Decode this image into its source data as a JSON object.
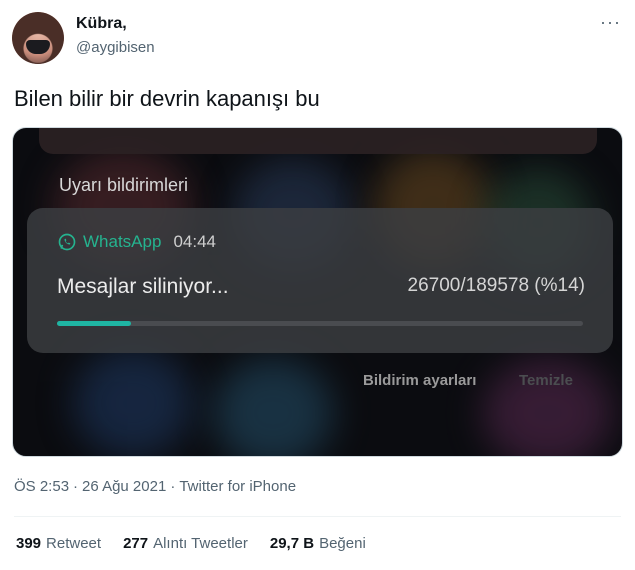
{
  "tweet": {
    "author_name": "Kübra,",
    "author_handle": "@aygibisen",
    "text": "Bilen bilir bir devrin kapanışı bu",
    "more_glyph": "···",
    "timestamp": "ÖS 2:53",
    "separator1": "·",
    "date": "26 Ağu 2021",
    "separator2": "·",
    "source": "Twitter for iPhone"
  },
  "media": {
    "section_title": "Uyarı bildirimleri",
    "notification": {
      "app_icon": "whatsapp-icon",
      "app_name": "WhatsApp",
      "time": "04:44",
      "message": "Mesajlar siliniyor...",
      "progress_text": "26700/189578 (%14)",
      "progress_fraction": 0.14,
      "accent_color": "#1fb5a3"
    },
    "actions": {
      "settings_label": "Bildirim ayarları",
      "clear_label": "Temizle"
    }
  },
  "stats": [
    {
      "count": "399",
      "label": "Retweet"
    },
    {
      "count": "277",
      "label": "Alıntı Tweetler"
    },
    {
      "count": "29,7 B",
      "label": "Beğeni"
    }
  ]
}
